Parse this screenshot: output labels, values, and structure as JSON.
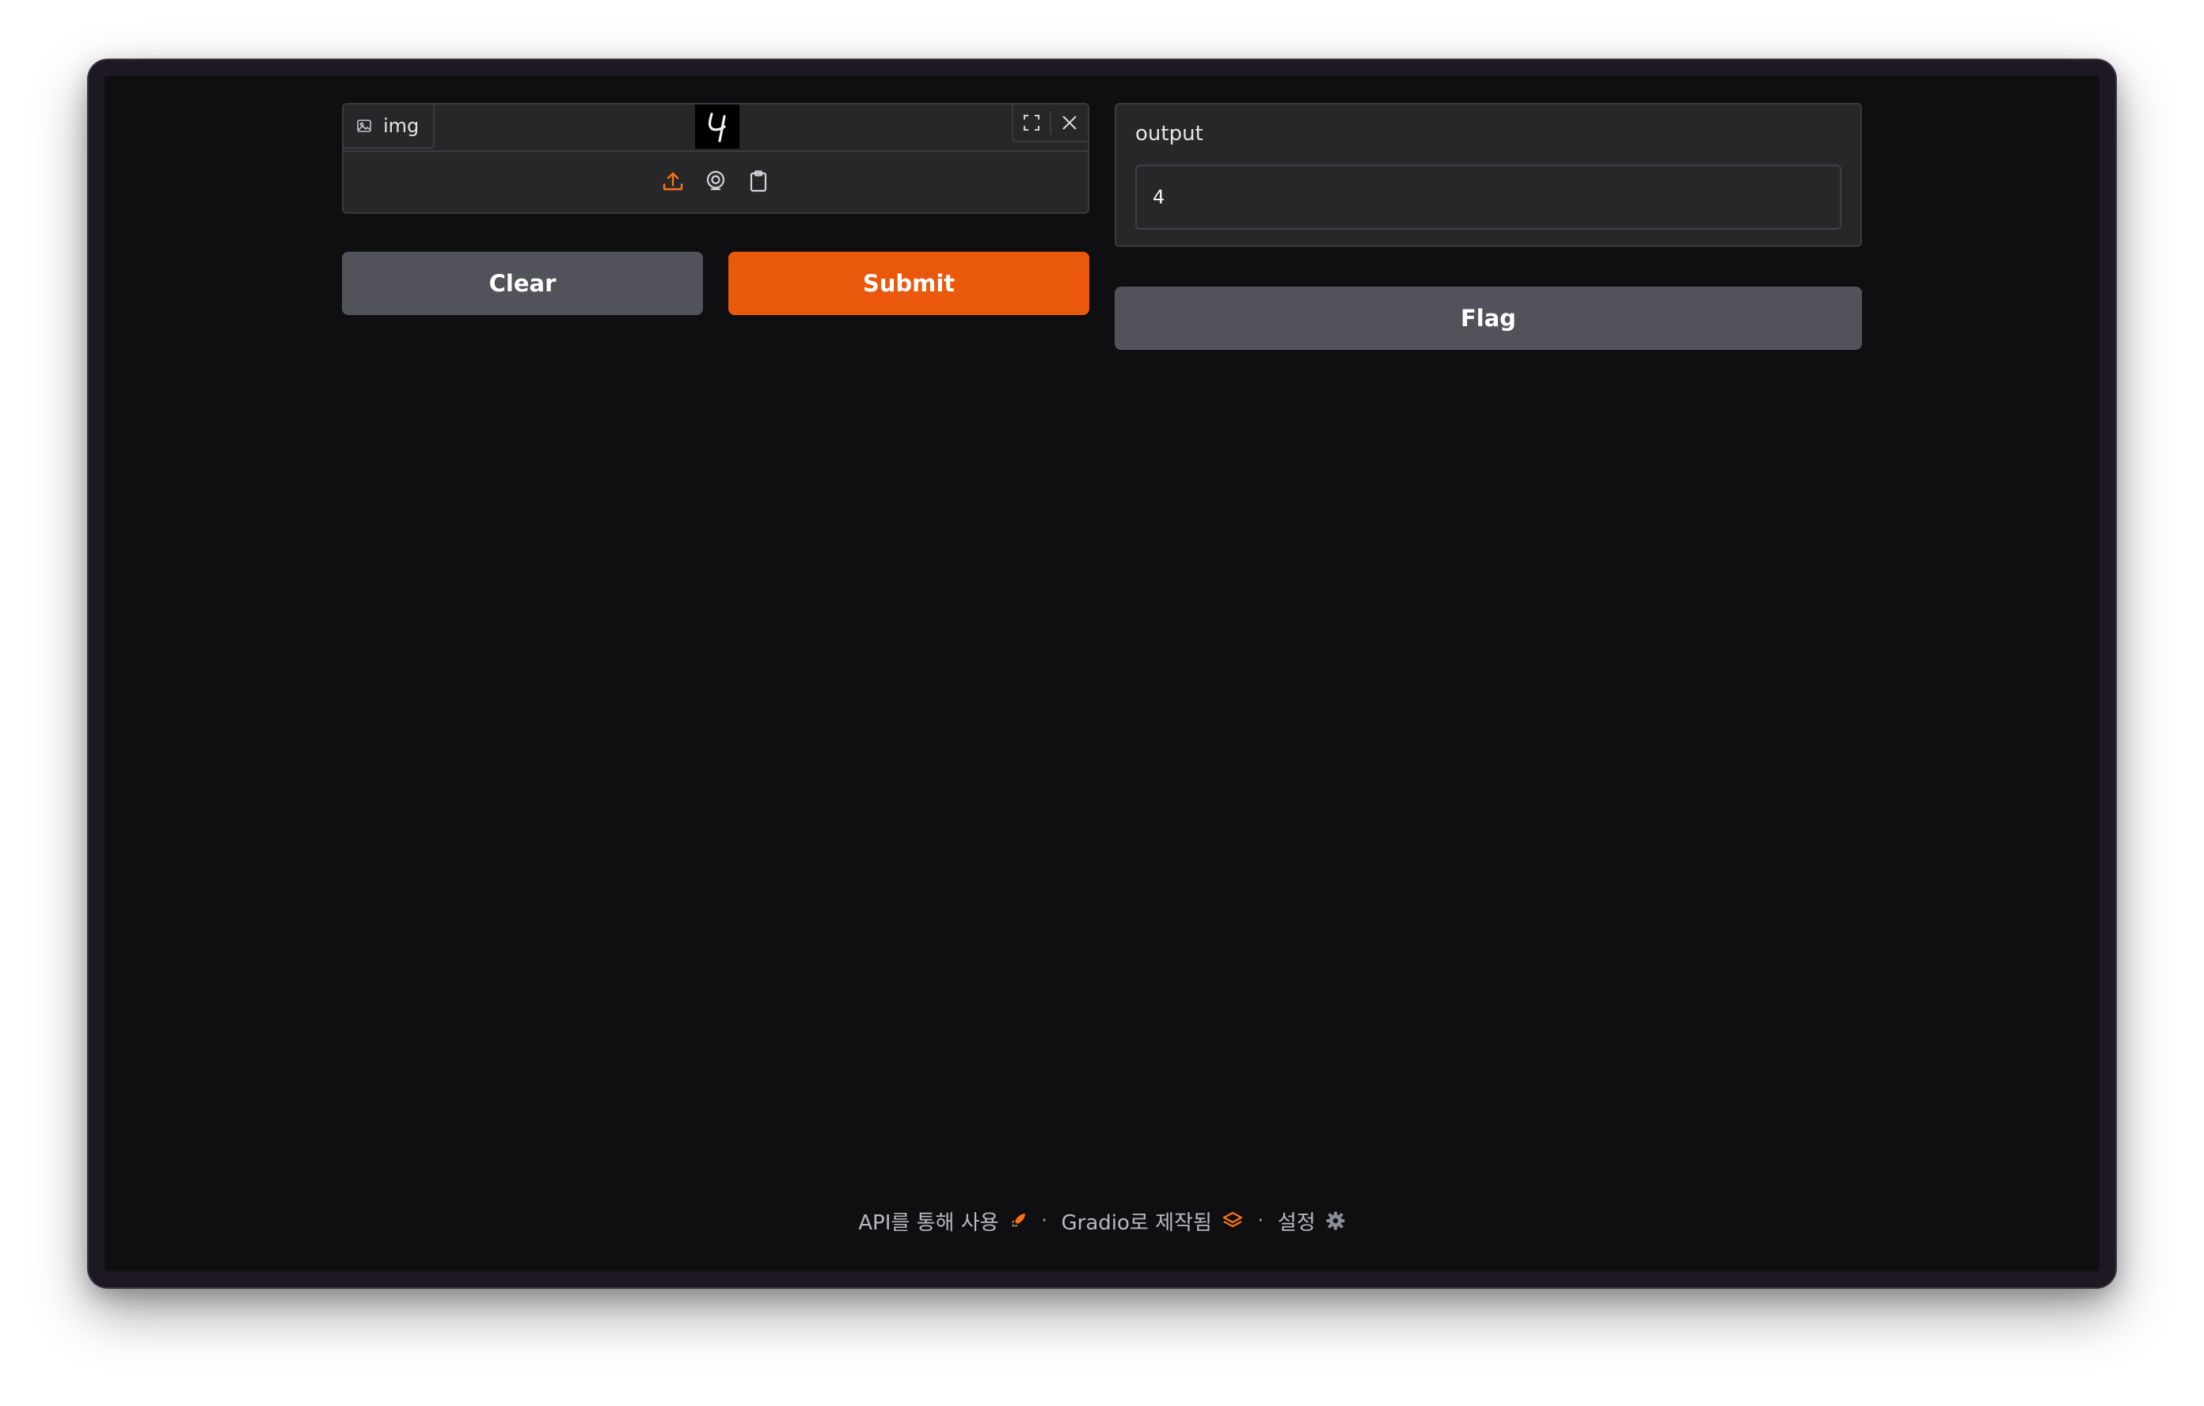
{
  "input": {
    "label": "img",
    "preview_digit": "4"
  },
  "buttons": {
    "clear": "Clear",
    "submit": "Submit",
    "flag": "Flag"
  },
  "output": {
    "label": "output",
    "value": "4"
  },
  "footer": {
    "api": "API를 통해 사용",
    "built_with": "Gradio로 제작됨",
    "settings": "설정",
    "separator": "·"
  },
  "colors": {
    "primary": "#ea580c",
    "secondary": "#52525b",
    "background": "#0f0f11",
    "panel": "#27272a"
  },
  "icons": {
    "label": "image-icon",
    "fullscreen": "fullscreen-icon",
    "close": "close-icon",
    "upload": "upload-icon",
    "webcam": "webcam-icon",
    "clipboard": "clipboard-icon",
    "api": "rocket-icon",
    "gradio": "gradio-logo-icon",
    "settings": "gear-icon"
  }
}
